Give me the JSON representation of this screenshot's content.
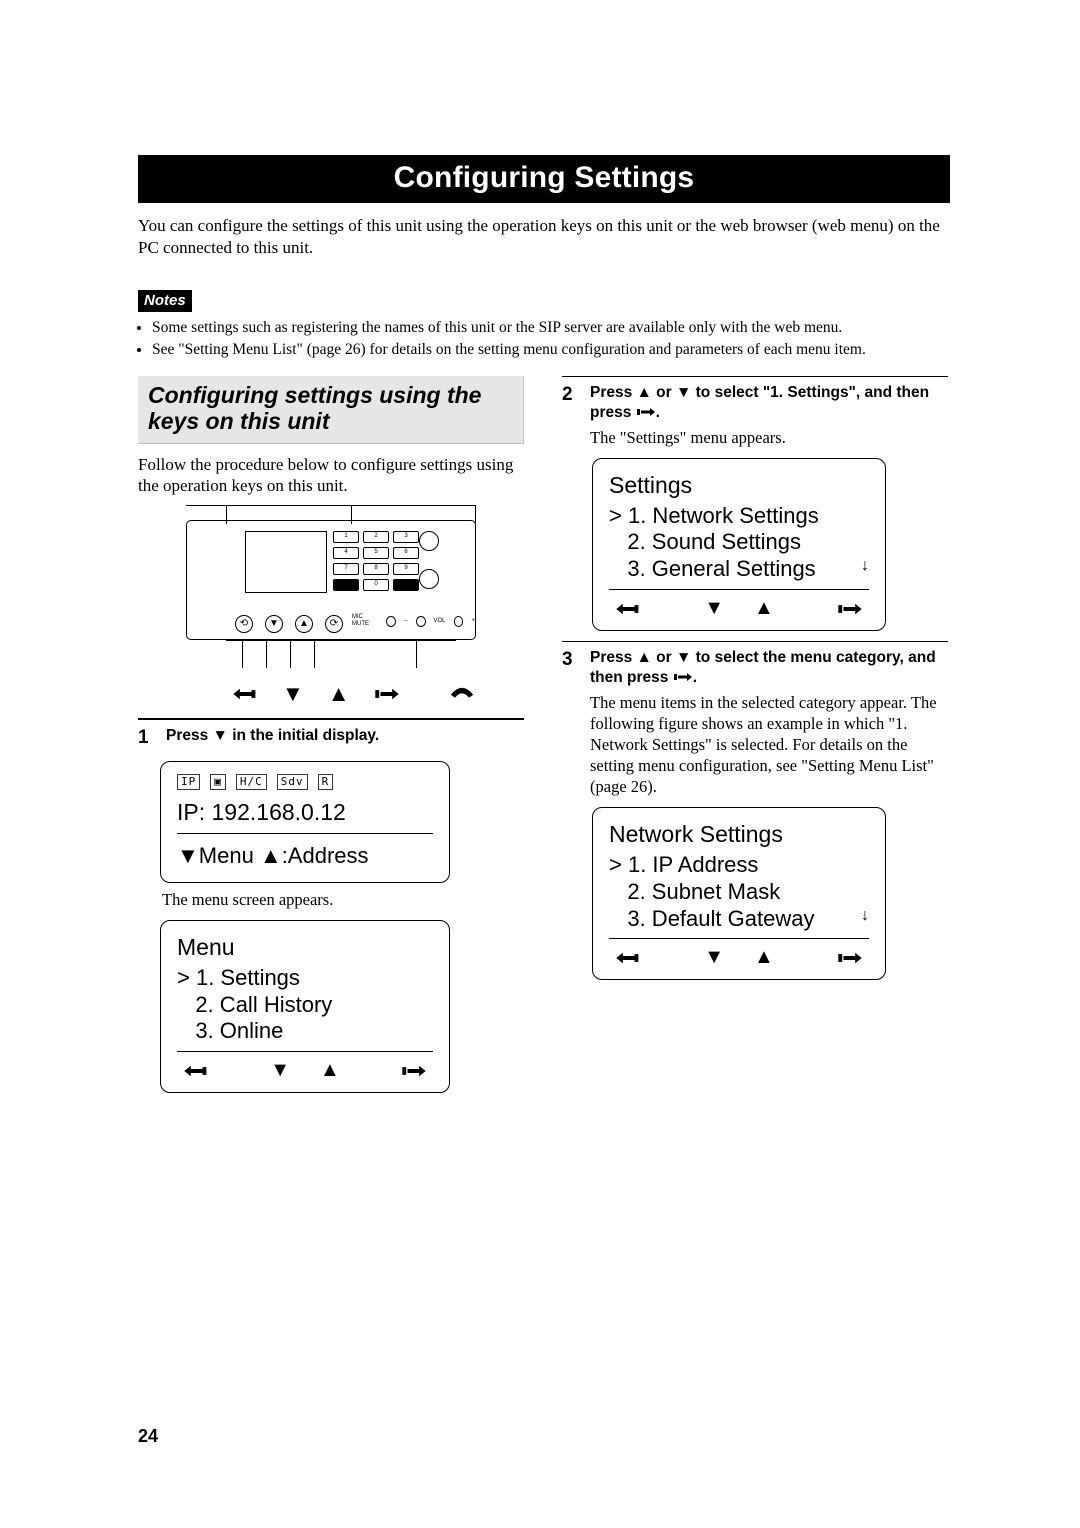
{
  "banner_title": "Configuring Settings",
  "intro": "You can configure the settings of this unit using the operation keys on this unit or the web browser (web menu) on the PC connected to this unit.",
  "notes_label": "Notes",
  "notes": [
    "Some settings such as registering the names of this unit or the SIP server are available only with the web menu.",
    "See \"Setting Menu List\" (page 26) for details on the setting menu configuration and parameters of each menu item."
  ],
  "subheading": "Configuring settings using the keys on this unit",
  "lead": "Follow the procedure below to configure settings using the operation keys on this unit.",
  "device_icons": [
    "back-icon",
    "down-icon",
    "up-icon",
    "enter-icon",
    "hook-icon"
  ],
  "step1": {
    "num": "1",
    "instruction_pre": "Press ",
    "instruction_key": "▼",
    "instruction_post": " in the initial display.",
    "lcd_initial": {
      "status_icons": [
        "IP",
        "▣",
        "H/C",
        "Sdv",
        "R"
      ],
      "line": "IP: 192.168.0.12",
      "footer": "▼Menu ▲:Address"
    },
    "after1": "The menu screen appears.",
    "lcd_menu": {
      "title": "Menu",
      "items": [
        "1. Settings",
        "2. Call History",
        "3. Online"
      ],
      "selected_index": 0
    }
  },
  "step2": {
    "num": "2",
    "instruction": "Press ▲ or ▼ to select \"1. Settings\", and then press ",
    "instruction_post": ".",
    "result": "The \"Settings\" menu appears.",
    "lcd": {
      "title": "Settings",
      "items": [
        "1. Network Settings",
        "2. Sound Settings",
        "3. General Settings"
      ],
      "selected_index": 0,
      "scroll_indicator": "↓"
    }
  },
  "step3": {
    "num": "3",
    "instruction": "Press ▲ or ▼ to select the menu category, and then press ",
    "instruction_post": ".",
    "result": "The menu items in the selected category appear. The following figure shows an example in which \"1. Network Settings\" is selected. For details on the setting menu configuration, see \"Setting Menu List\" (page 26).",
    "lcd": {
      "title": "Network Settings",
      "items": [
        "1. IP Address",
        "2. Subnet Mask",
        "3. Default Gateway"
      ],
      "selected_index": 0,
      "scroll_indicator": "↓"
    }
  },
  "page_number": "24"
}
